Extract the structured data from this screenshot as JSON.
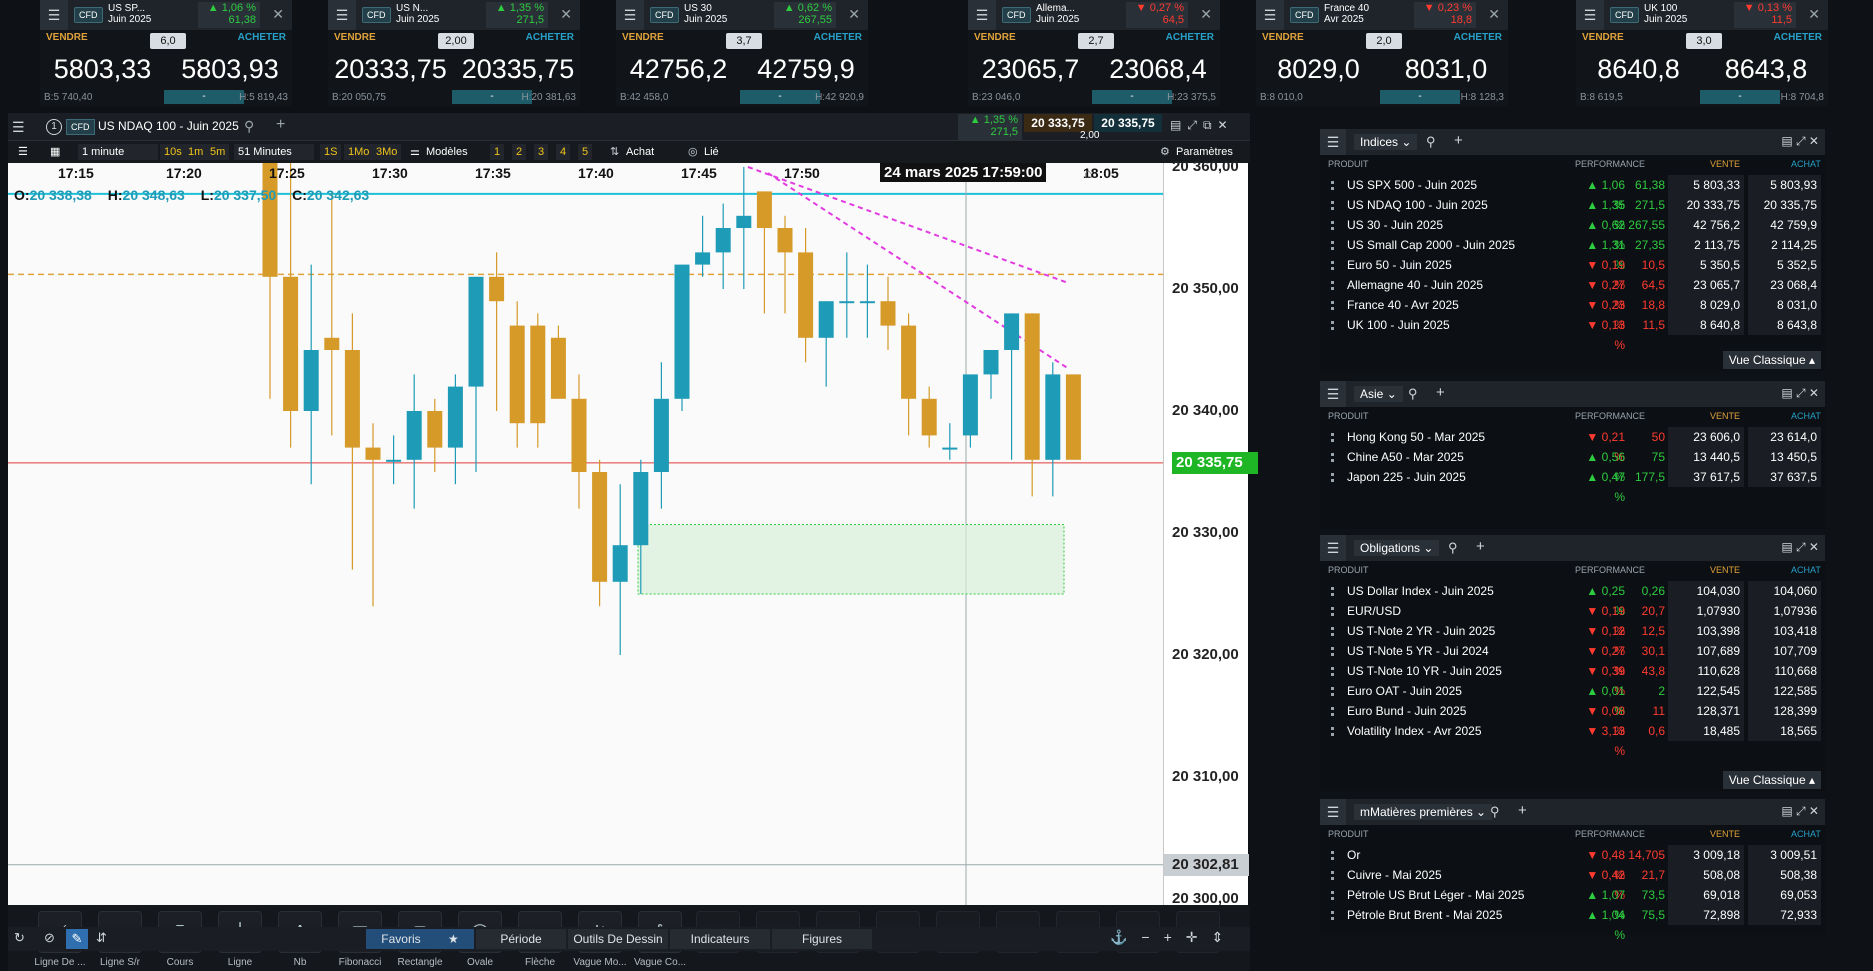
{
  "tickers": [
    {
      "name": "US SP...",
      "sub": "Juin 2025",
      "perf": "1,06 %",
      "chg": "61,38",
      "dir": "up",
      "spread": "6,0",
      "sell": "5803,33",
      "buy": "5803,93",
      "low": "B:5 740,40",
      "high": "H:5 819,43"
    },
    {
      "name": "US N...",
      "sub": "Juin 2025",
      "perf": "1,35 %",
      "chg": "271,5",
      "dir": "up",
      "spread": "2,00",
      "sell": "20333,75",
      "buy": "20335,75",
      "low": "B:20 050,75",
      "high": "H:20 381,63"
    },
    {
      "name": "US 30",
      "sub": "Juin 2025",
      "perf": "0,62 %",
      "chg": "267,55",
      "dir": "up",
      "spread": "3,7",
      "sell": "42756,2",
      "buy": "42759,9",
      "low": "B:42 458,0",
      "high": "H:42 920,9"
    },
    {
      "name": "Allema...",
      "sub": "Juin 2025",
      "perf": "0,27 %",
      "chg": "64,5",
      "dir": "dn",
      "spread": "2,7",
      "sell": "23065,7",
      "buy": "23068,4",
      "low": "B:23 046,0",
      "high": "H:23 375,5"
    },
    {
      "name": "France 40",
      "sub": "Avr 2025",
      "perf": "0,23 %",
      "chg": "18,8",
      "dir": "dn",
      "spread": "2,0",
      "sell": "8029,0",
      "buy": "8031,0",
      "low": "B:8 010,0",
      "high": "H:8 128,3"
    },
    {
      "name": "UK 100",
      "sub": "Juin 2025",
      "perf": "0,13 %",
      "chg": "11,5",
      "dir": "dn",
      "spread": "3,0",
      "sell": "8640,8",
      "buy": "8643,8",
      "low": "B:8 619,5",
      "high": "H:8 704,8"
    }
  ],
  "labels": {
    "vendre": "VENDRE",
    "acheter": "ACHETER",
    "cfd": "CFD",
    "dd": "-"
  },
  "chart": {
    "window_num": "1",
    "title": "US NDAQ 100 - Juin 2025",
    "perf": "1,35 %",
    "chg": "271,5",
    "sell": "20 333,75",
    "buy": "20 335,75",
    "spread": "2,00",
    "interval": "1 minute",
    "range": "51 Minutes",
    "periods1": [
      "10s",
      "1m",
      "5m"
    ],
    "periods2": [
      "1S",
      "1Mo",
      "3Mo"
    ],
    "modeles": "Modèles",
    "nums": [
      "1",
      "2",
      "3",
      "4",
      "5"
    ],
    "achat": "Achat",
    "lie": "Lié",
    "parametres": "Paramètres",
    "times": [
      "17:15",
      "17:20",
      "17:25",
      "17:30",
      "17:35",
      "17:40",
      "17:45",
      "17:50",
      "18:05"
    ],
    "date_label": "24 mars 2025 17:59:00",
    "ohlc": {
      "o_label": "O:",
      "o": "20 338,38",
      "h_label": "H:",
      "h": "20 348,63",
      "l_label": "L:",
      "l": "20 337,50",
      "c_label": "C:",
      "c": "20 342,63"
    },
    "price_labels": [
      "20 360,00",
      "20 350,00",
      "20 340,00",
      "20 330,00",
      "20 320,00",
      "20 310,00",
      "20 300,00"
    ],
    "current_price": "20 335,75",
    "cursor_price": "20 302,81",
    "colors": {
      "up": "#1e9bb6",
      "down": "#d59a28",
      "current": "#1fb626",
      "hline": "#e0a33a",
      "trend": "#e23be0"
    }
  },
  "candles": [
    {
      "o": 20361.0,
      "h": 20364.0,
      "l": 20341.0,
      "c": 20351.0
    },
    {
      "o": 20351.0,
      "h": 20365.0,
      "l": 20337.0,
      "c": 20340.0
    },
    {
      "o": 20340.0,
      "h": 20352.0,
      "l": 20334.0,
      "c": 20345.0
    },
    {
      "o": 20346.0,
      "h": 20358.0,
      "l": 20338.0,
      "c": 20345.0
    },
    {
      "o": 20345.0,
      "h": 20348.0,
      "l": 20327.0,
      "c": 20337.0
    },
    {
      "o": 20337.0,
      "h": 20339.0,
      "l": 20324.0,
      "c": 20336.0
    },
    {
      "o": 20336.0,
      "h": 20338.0,
      "l": 20334.0,
      "c": 20336.0
    },
    {
      "o": 20336.0,
      "h": 20343.0,
      "l": 20332.0,
      "c": 20340.0
    },
    {
      "o": 20340.0,
      "h": 20341.0,
      "l": 20335.0,
      "c": 20337.0
    },
    {
      "o": 20337.0,
      "h": 20343.0,
      "l": 20334.0,
      "c": 20342.0
    },
    {
      "o": 20342.0,
      "h": 20351.0,
      "l": 20335.0,
      "c": 20351.0
    },
    {
      "o": 20351.0,
      "h": 20353.0,
      "l": 20340.0,
      "c": 20349.0
    },
    {
      "o": 20347.0,
      "h": 20349.0,
      "l": 20337.0,
      "c": 20339.0
    },
    {
      "o": 20347.0,
      "h": 20348.0,
      "l": 20337.0,
      "c": 20339.0
    },
    {
      "o": 20346.0,
      "h": 20347.0,
      "l": 20341.0,
      "c": 20341.0
    },
    {
      "o": 20341.0,
      "h": 20343.0,
      "l": 20332.0,
      "c": 20335.0
    },
    {
      "o": 20335.0,
      "h": 20336.0,
      "l": 20324.0,
      "c": 20326.0
    },
    {
      "o": 20326.0,
      "h": 20334.0,
      "l": 20320.0,
      "c": 20329.0
    },
    {
      "o": 20329.0,
      "h": 20336.0,
      "l": 20325.0,
      "c": 20335.0
    },
    {
      "o": 20335.0,
      "h": 20344.0,
      "l": 20332.0,
      "c": 20341.0
    },
    {
      "o": 20341.0,
      "h": 20351.0,
      "l": 20340.0,
      "c": 20352.0
    },
    {
      "o": 20352.0,
      "h": 20356.0,
      "l": 20351.0,
      "c": 20353.0
    },
    {
      "o": 20353.0,
      "h": 20357.0,
      "l": 20350.0,
      "c": 20355.0
    },
    {
      "o": 20355.0,
      "h": 20360.0,
      "l": 20350.0,
      "c": 20356.0
    },
    {
      "o": 20358.0,
      "h": 20358.0,
      "l": 20348.0,
      "c": 20355.0
    },
    {
      "o": 20355.0,
      "h": 20356.0,
      "l": 20348.0,
      "c": 20353.0
    },
    {
      "o": 20353.0,
      "h": 20355.0,
      "l": 20344.0,
      "c": 20346.0
    },
    {
      "o": 20346.0,
      "h": 20349.0,
      "l": 20342.0,
      "c": 20349.0
    },
    {
      "o": 20349.0,
      "h": 20353.0,
      "l": 20346.0,
      "c": 20349.0
    },
    {
      "o": 20349.0,
      "h": 20352.0,
      "l": 20346.0,
      "c": 20349.0
    },
    {
      "o": 20349.0,
      "h": 20351.0,
      "l": 20345.0,
      "c": 20347.0
    },
    {
      "o": 20347.0,
      "h": 20348.0,
      "l": 20338.0,
      "c": 20341.0
    },
    {
      "o": 20341.0,
      "h": 20342.0,
      "l": 20337.0,
      "c": 20338.0
    },
    {
      "o": 20337.0,
      "h": 20339.0,
      "l": 20336.0,
      "c": 20337.0
    },
    {
      "o": 20338.0,
      "h": 20343.0,
      "l": 20337.0,
      "c": 20343.0
    },
    {
      "o": 20343.0,
      "h": 20345.0,
      "l": 20341.0,
      "c": 20345.0
    },
    {
      "o": 20345.0,
      "h": 20348.0,
      "l": 20336.0,
      "c": 20348.0
    },
    {
      "o": 20348.0,
      "h": 20348.0,
      "l": 20333.0,
      "c": 20336.0
    },
    {
      "o": 20336.0,
      "h": 20344.0,
      "l": 20333.0,
      "c": 20343.0
    },
    {
      "o": 20343.0,
      "h": 20343.0,
      "l": 20337.0,
      "c": 20336.0
    }
  ],
  "draw_tools": [
    "Ligne De ...",
    "Ligne S/r",
    "Cours",
    "Ligne",
    "Nb",
    "Fibonacci",
    "Rectangle",
    "Ovale",
    "Flèche",
    "Vague Mo...",
    "Vague Co..."
  ],
  "bottom_tabs": {
    "favoris": "Favoris",
    "periode": "Période",
    "outils": "Outils De Dessin",
    "indicateurs": "Indicateurs",
    "figures": "Figures"
  },
  "col_headers": {
    "produit": "PRODUIT",
    "performance": "PERFORMANCE",
    "vente": "VENTE",
    "achat": "ACHAT"
  },
  "vue_classique": "Vue Classique",
  "panels": [
    {
      "title": "Indices",
      "rows": [
        {
          "name": "US SPX 500 - Juin 2025",
          "pct": "1,06 %",
          "chg": "61,38",
          "dir": "up",
          "sell": "5 803,33",
          "buy": "5 803,93"
        },
        {
          "name": "US NDAQ 100 - Juin 2025",
          "pct": "1,35 %",
          "chg": "271,5",
          "dir": "up",
          "sell": "20 333,75",
          "buy": "20 335,75"
        },
        {
          "name": "US 30 - Juin 2025",
          "pct": "0,62 %",
          "chg": "267,55",
          "dir": "up",
          "sell": "42 756,2",
          "buy": "42 759,9"
        },
        {
          "name": "US Small Cap 2000 - Juin 2025",
          "pct": "1,31 %",
          "chg": "27,35",
          "dir": "up",
          "sell": "2 113,75",
          "buy": "2 114,25"
        },
        {
          "name": "Euro 50 - Juin 2025",
          "pct": "0,19 %",
          "chg": "10,5",
          "dir": "dn",
          "sell": "5 350,5",
          "buy": "5 352,5"
        },
        {
          "name": "Allemagne 40 - Juin 2025",
          "pct": "0,27 %",
          "chg": "64,5",
          "dir": "dn",
          "sell": "23 065,7",
          "buy": "23 068,4"
        },
        {
          "name": "France 40 - Avr 2025",
          "pct": "0,23 %",
          "chg": "18,8",
          "dir": "dn",
          "sell": "8 029,0",
          "buy": "8 031,0"
        },
        {
          "name": "UK 100 - Juin 2025",
          "pct": "0,13 %",
          "chg": "11,5",
          "dir": "dn",
          "sell": "8 640,8",
          "buy": "8 643,8"
        }
      ]
    },
    {
      "title": "Asie",
      "rows": [
        {
          "name": "Hong Kong 50 - Mar 2025",
          "pct": "0,21 %",
          "chg": "50",
          "dir": "dn",
          "sell": "23 606,0",
          "buy": "23 614,0"
        },
        {
          "name": "Chine A50 - Mar 2025",
          "pct": "0,56 %",
          "chg": "75",
          "dir": "up",
          "sell": "13 440,5",
          "buy": "13 450,5"
        },
        {
          "name": "Japon 225 - Juin 2025",
          "pct": "0,47 %",
          "chg": "177,5",
          "dir": "up",
          "sell": "37 617,5",
          "buy": "37 637,5"
        }
      ]
    },
    {
      "title": "Obligations",
      "rows": [
        {
          "name": "US Dollar Index - Juin 2025",
          "pct": "0,25 %",
          "chg": "0,26",
          "dir": "up",
          "sell": "104,030",
          "buy": "104,060"
        },
        {
          "name": "EUR/USD",
          "pct": "0,19 %",
          "chg": "20,7",
          "dir": "dn",
          "sell": "1,07930",
          "buy": "1,07936"
        },
        {
          "name": "US T-Note 2 YR - Juin 2025",
          "pct": "0,12 %",
          "chg": "12,5",
          "dir": "dn",
          "sell": "103,398",
          "buy": "103,418"
        },
        {
          "name": "US T-Note 5 YR - Jui 2024",
          "pct": "0,27 %",
          "chg": "30,1",
          "dir": "dn",
          "sell": "107,689",
          "buy": "107,709"
        },
        {
          "name": "US T-Note 10 YR - Juin 2025",
          "pct": "0,39 %",
          "chg": "43,8",
          "dir": "dn",
          "sell": "110,628",
          "buy": "110,668"
        },
        {
          "name": "Euro OAT - Juin 2025",
          "pct": "0,01 %",
          "chg": "2",
          "dir": "up",
          "sell": "122,545",
          "buy": "122,585"
        },
        {
          "name": "Euro Bund - Juin 2025",
          "pct": "0,08 %",
          "chg": "11",
          "dir": "dn",
          "sell": "128,371",
          "buy": "128,399"
        },
        {
          "name": "Volatility Index - Avr 2025",
          "pct": "3,13 %",
          "chg": "0,6",
          "dir": "dn",
          "sell": "18,485",
          "buy": "18,565"
        }
      ]
    },
    {
      "title": "mMatières premières",
      "rows": [
        {
          "name": "Or",
          "pct": "0,48 %",
          "chg": "14,705",
          "dir": "dn",
          "sell": "3 009,18",
          "buy": "3 009,51"
        },
        {
          "name": "Cuivre - Mai 2025",
          "pct": "0,42 %",
          "chg": "21,7",
          "dir": "dn",
          "sell": "508,08",
          "buy": "508,38"
        },
        {
          "name": "Pétrole US Brut Léger - Mai 2025",
          "pct": "1,07 %",
          "chg": "73,5",
          "dir": "up",
          "sell": "69,018",
          "buy": "69,053"
        },
        {
          "name": "Pétrole Brut Brent - Mai 2025",
          "pct": "1,04 %",
          "chg": "75,5",
          "dir": "up",
          "sell": "72,898",
          "buy": "72,933"
        }
      ]
    }
  ]
}
